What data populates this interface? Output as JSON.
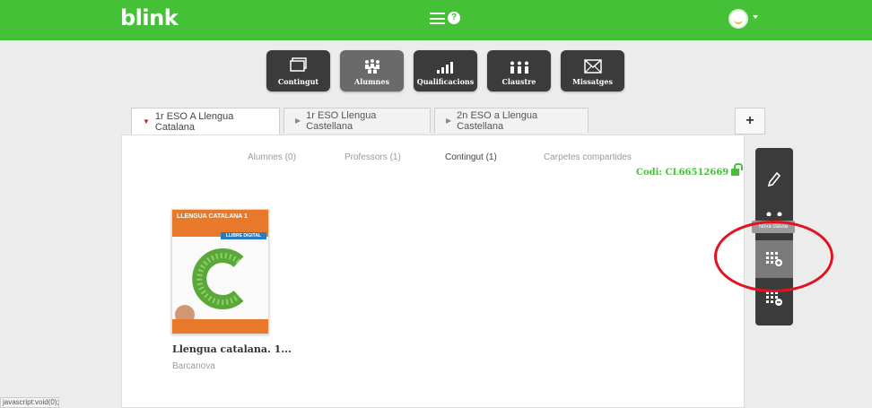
{
  "app": {
    "logo": "blink"
  },
  "header": {
    "menu_icon": "hamburger-icon",
    "help_icon": "help-icon",
    "help_glyph": "?",
    "avatar": "smiley-avatar"
  },
  "nav": [
    {
      "label": "Contingut",
      "icon": "screen-icon",
      "active": false
    },
    {
      "label": "Alumnes",
      "icon": "students-icon",
      "active": true
    },
    {
      "label": "Qualificacions",
      "icon": "bar-chart-icon",
      "active": false
    },
    {
      "label": "Claustre",
      "icon": "teachers-icon",
      "active": false
    },
    {
      "label": "Missatges",
      "icon": "envelope-icon",
      "active": false
    }
  ],
  "tabs": [
    {
      "label": "1r ESO A Llengua Catalana",
      "active": true
    },
    {
      "label": "1r ESO Llengua Castellana",
      "active": false
    },
    {
      "label": "2n ESO a Llengua Castellana",
      "active": false
    }
  ],
  "add_tab_label": "+",
  "subtabs": [
    {
      "label": "Alumnes (0)",
      "active": false
    },
    {
      "label": "Professors (1)",
      "active": false
    },
    {
      "label": "Contingut (1)",
      "active": true
    },
    {
      "label": "Carpetes compartides",
      "active": false
    }
  ],
  "codi": "Codi: CL66512669",
  "book": {
    "cover_title": "LLENGUA CATALANA 1",
    "cover_badge": "LLIBRE DIGITAL",
    "title": "Llengua catalana. 1...",
    "publisher": "Barcanova"
  },
  "sidebar": {
    "tooltip": "Nova classe"
  },
  "status_bar": "javascript:void(0);",
  "colors": {
    "brand": "#44c137",
    "dark": "#3b3b3b",
    "highlight": "#e4121f"
  }
}
